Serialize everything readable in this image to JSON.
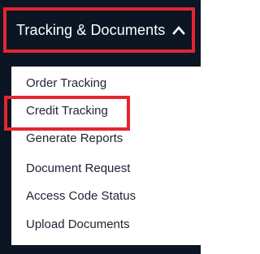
{
  "menu": {
    "header_label": "Tracking & Documents",
    "header_expanded_icon": "chevron-up-icon",
    "items": [
      {
        "label": "Order Tracking"
      },
      {
        "label": "Credit Tracking",
        "highlighted": true
      },
      {
        "label": "Generate Reports"
      },
      {
        "label": "Document Request"
      },
      {
        "label": "Access Code Status"
      },
      {
        "label": "Upload Documents"
      }
    ]
  },
  "colors": {
    "panel_background": "#0b1524",
    "highlight_border": "#e3262e",
    "dropdown_background": "#ffffff",
    "item_text": "#1b2433",
    "header_text": "#ffffff"
  }
}
